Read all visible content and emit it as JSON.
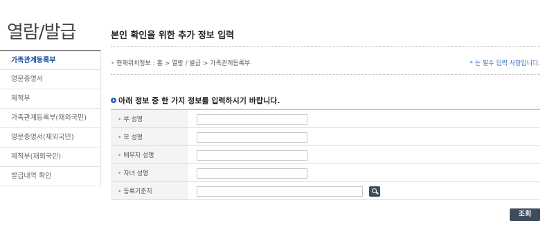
{
  "sidebar": {
    "title": "열람/발급",
    "items": [
      {
        "label": "가족관계등록부"
      },
      {
        "label": "영문증명서"
      },
      {
        "label": "제적부"
      },
      {
        "label": "가족관계등록부(재외국민)"
      },
      {
        "label": "영문증명서(재외국민)"
      },
      {
        "label": "제적부(재외국민)"
      },
      {
        "label": "발급내역 확인"
      }
    ],
    "active_index": 0
  },
  "main": {
    "title": "본인 확인을 위한 추가 정보 입력",
    "breadcrumb": "현재위치정보 : 홈 > 열람 / 발급 > 가족관계등록부",
    "required_note": "* 는 필수 입력 사항입니다.",
    "section_heading": "아래 정보 중 한 가지 정보를 입력하시기 바랍니다.",
    "fields": [
      {
        "label": "부 성명",
        "value": ""
      },
      {
        "label": "모 성명",
        "value": ""
      },
      {
        "label": "배우자 성명",
        "value": ""
      },
      {
        "label": "자녀 성명",
        "value": ""
      },
      {
        "label": "등록기준지",
        "value": ""
      }
    ],
    "submit_label": "조회"
  },
  "colors": {
    "accent": "#1a4f9c",
    "button_bg": "#3d4d5c",
    "note": "#3a74c0"
  }
}
